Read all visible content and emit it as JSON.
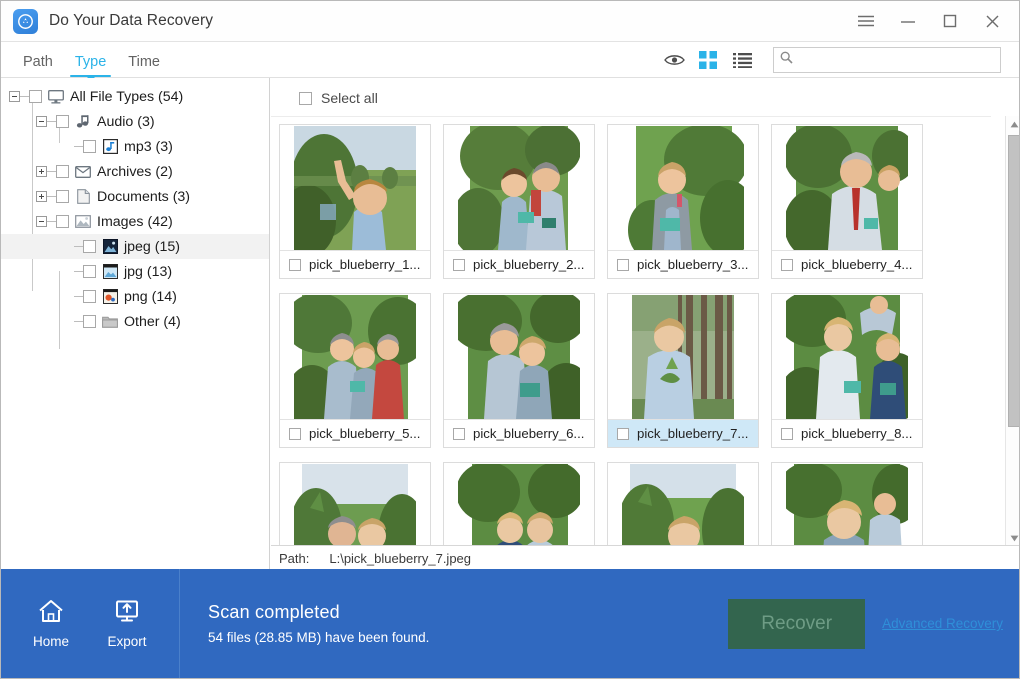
{
  "window": {
    "title": "Do Your Data Recovery",
    "logo_icon": "shield-recovery-logo",
    "controls": [
      {
        "name": "menu",
        "icon": "hamburger-menu-icon"
      },
      {
        "name": "minimize",
        "icon": "minimize-icon"
      },
      {
        "name": "maximize",
        "icon": "maximize-icon"
      },
      {
        "name": "close",
        "icon": "close-icon"
      }
    ]
  },
  "tabs": [
    {
      "label": "Path",
      "active": false
    },
    {
      "label": "Type",
      "active": true
    },
    {
      "label": "Time",
      "active": false
    }
  ],
  "toolbar": {
    "icons": [
      {
        "name": "preview-eye-icon",
        "label": "Preview",
        "active": false
      },
      {
        "name": "grid-view-icon",
        "label": "Grid view",
        "active": true
      },
      {
        "name": "list-view-icon",
        "label": "List view",
        "active": false
      }
    ],
    "search": {
      "value": "",
      "placeholder": "",
      "icon": "search-icon"
    }
  },
  "sidebar": {
    "tree": [
      {
        "label": "All File Types (54)",
        "depth": 0,
        "expander": "minus",
        "icon": "computer-icon",
        "checked": false
      },
      {
        "label": "Audio (3)",
        "depth": 1,
        "expander": "minus",
        "icon": "audio-icon",
        "checked": false
      },
      {
        "label": "mp3 (3)",
        "depth": 2,
        "expander": "none",
        "icon": "mp3-file-icon",
        "checked": false
      },
      {
        "label": "Archives (2)",
        "depth": 1,
        "expander": "plus",
        "icon": "archive-icon",
        "checked": false
      },
      {
        "label": "Documents (3)",
        "depth": 1,
        "expander": "plus",
        "icon": "document-icon",
        "checked": false
      },
      {
        "label": "Images (42)",
        "depth": 1,
        "expander": "minus",
        "icon": "image-icon",
        "checked": false
      },
      {
        "label": "jpeg (15)",
        "depth": 2,
        "expander": "none",
        "icon": "jpeg-file-icon",
        "checked": false,
        "highlight": true
      },
      {
        "label": "jpg (13)",
        "depth": 2,
        "expander": "none",
        "icon": "jpg-file-icon",
        "checked": false
      },
      {
        "label": "png (14)",
        "depth": 2,
        "expander": "none",
        "icon": "png-file-icon",
        "checked": false
      },
      {
        "label": "Other (4)",
        "depth": 1,
        "expander": "none",
        "icon": "folder-icon",
        "checked": false
      }
    ]
  },
  "main": {
    "select_all_label": "Select all",
    "select_all_checked": false,
    "files": [
      {
        "label": "pick_blueberry_1...",
        "checked": false,
        "selected": false,
        "scene": "boy-reaching-bush"
      },
      {
        "label": "pick_blueberry_2...",
        "checked": false,
        "selected": false,
        "scene": "couple-in-bushes"
      },
      {
        "label": "pick_blueberry_3...",
        "checked": false,
        "selected": false,
        "scene": "woman-holding-punnet"
      },
      {
        "label": "pick_blueberry_4...",
        "checked": false,
        "selected": false,
        "scene": "man-red-tie-picking"
      },
      {
        "label": "pick_blueberry_5...",
        "checked": false,
        "selected": false,
        "scene": "family-group-bushes"
      },
      {
        "label": "pick_blueberry_6...",
        "checked": false,
        "selected": false,
        "scene": "man-and-boy-picking"
      },
      {
        "label": "pick_blueberry_7...",
        "checked": false,
        "selected": true,
        "scene": "woman-by-trees"
      },
      {
        "label": "pick_blueberry_8...",
        "checked": false,
        "selected": false,
        "scene": "boys-with-punnets"
      },
      {
        "label": "",
        "checked": false,
        "selected": false,
        "scene": "man-and-woman-smiling"
      },
      {
        "label": "",
        "checked": false,
        "selected": false,
        "scene": "two-boys-standing"
      },
      {
        "label": "",
        "checked": false,
        "selected": false,
        "scene": "woman-eating-berry"
      },
      {
        "label": "",
        "checked": false,
        "selected": false,
        "scene": "boy-and-man-field"
      }
    ],
    "path_label": "Path:",
    "path_value": "L:\\pick_blueberry_7.jpeg",
    "scrollbar": {
      "up_icon": "scroll-up-arrow-icon",
      "down_icon": "scroll-down-arrow-icon"
    }
  },
  "bottom": {
    "nav": [
      {
        "label": "Home",
        "icon": "home-icon"
      },
      {
        "label": "Export",
        "icon": "export-icon"
      }
    ],
    "status_title": "Scan completed",
    "status_detail": "54 files (28.85 MB) have been found.",
    "recover_label": "Recover",
    "recover_enabled": false,
    "advanced_link": "Advanced Recovery"
  },
  "colors": {
    "brand_blue": "#3069c0",
    "accent_cyan": "#2bb3e8",
    "recover_green": "#33654e",
    "selection_blue": "#cfe8f7"
  }
}
